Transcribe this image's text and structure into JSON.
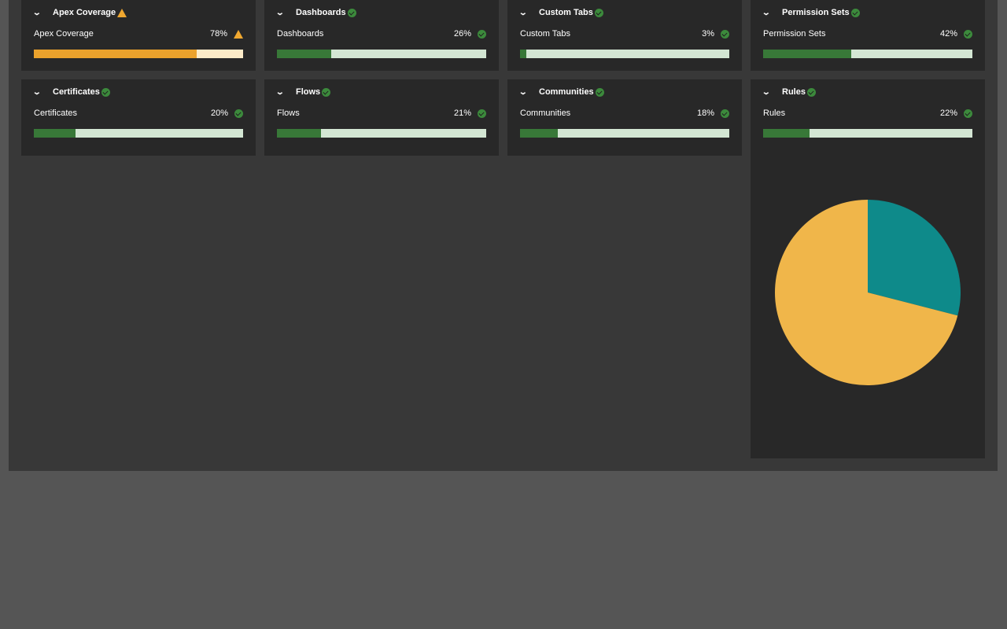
{
  "cards": [
    {
      "title": "Apex Coverage",
      "label": "Apex Coverage",
      "value": "78%",
      "percent": 78,
      "status": "warning"
    },
    {
      "title": "Dashboards",
      "label": "Dashboards",
      "value": "26%",
      "percent": 26,
      "status": "ok"
    },
    {
      "title": "Custom Tabs",
      "label": "Custom Tabs",
      "value": "3%",
      "percent": 3,
      "status": "ok"
    },
    {
      "title": "Permission Sets",
      "label": "Permission Sets",
      "value": "42%",
      "percent": 42,
      "status": "ok"
    },
    {
      "title": "Certificates",
      "label": "Certificates",
      "value": "20%",
      "percent": 20,
      "status": "ok"
    },
    {
      "title": "Flows",
      "label": "Flows",
      "value": "21%",
      "percent": 21,
      "status": "ok"
    },
    {
      "title": "Communities",
      "label": "Communities",
      "value": "18%",
      "percent": 18,
      "status": "ok"
    },
    {
      "title": "Rules",
      "label": "Rules",
      "value": "22%",
      "percent": 22,
      "status": "ok"
    }
  ],
  "colors": {
    "ok": "#3c8a3c",
    "warning": "#f0a830",
    "bar_ok": "#387838",
    "bar_warning": "#eba22c"
  },
  "pie": {
    "slices": [
      {
        "fraction": 0.29,
        "color": "#0e8a8a"
      },
      {
        "fraction": 0.71,
        "color": "#f0b64a"
      }
    ]
  }
}
